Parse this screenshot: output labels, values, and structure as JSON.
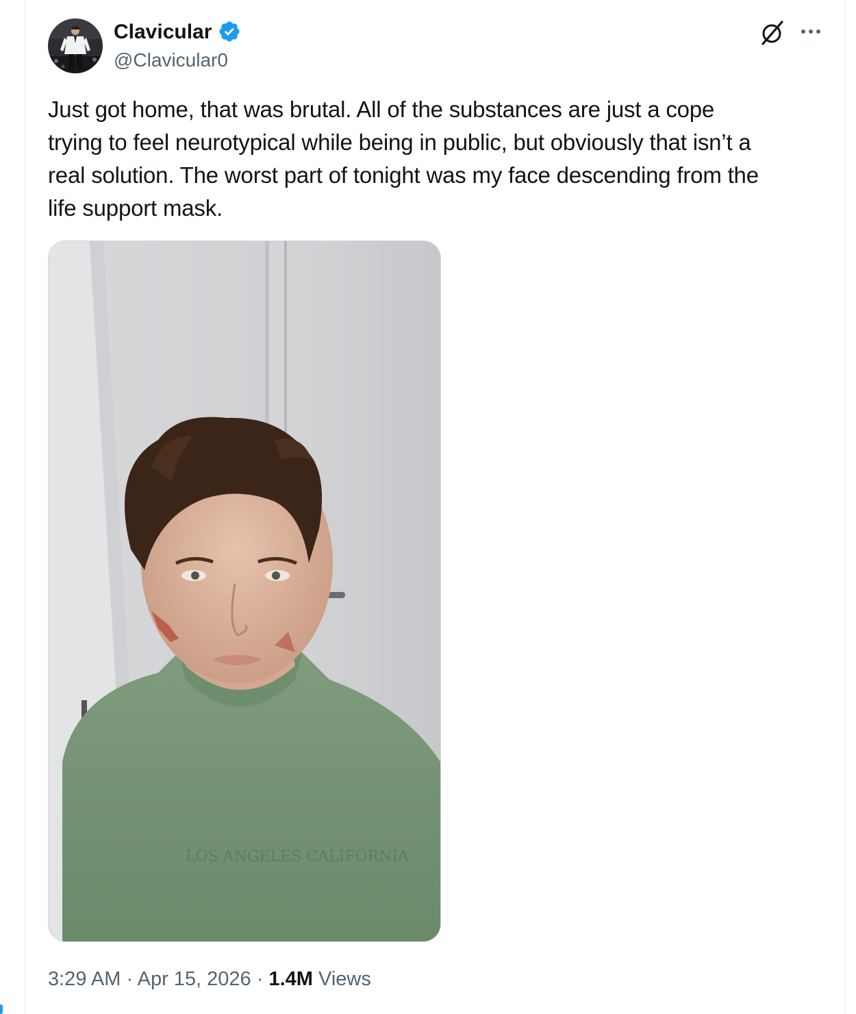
{
  "tweet": {
    "author": {
      "display_name": "Clavicular",
      "handle": "@Clavicular0",
      "verified": true,
      "avatar_icon": "avatar-photo-man-in-white-jacket"
    },
    "text": "Just got home, that was brutal. All of the substances are just a cope\ntrying to feel neurotypical while being in public, but obviously that isn’t a\nreal solution. The worst part of tonight was my face descending from the\nlife support mask.",
    "media": {
      "type": "photo",
      "icon": "selfie-photo",
      "shirt_print": "LOS ANGELES CALIFORNIA"
    },
    "meta": {
      "time": "3:29 AM",
      "separator": "·",
      "date": "Apr 15, 2026",
      "views_count": "1.4M",
      "views_label": "Views"
    },
    "actions": {
      "grok_icon": "grok-icon",
      "more_icon": "more-icon"
    }
  },
  "colors": {
    "text_primary": "#0f1419",
    "text_secondary": "#536471",
    "verified_blue": "#1d9bf0",
    "border": "#cfd9de"
  }
}
